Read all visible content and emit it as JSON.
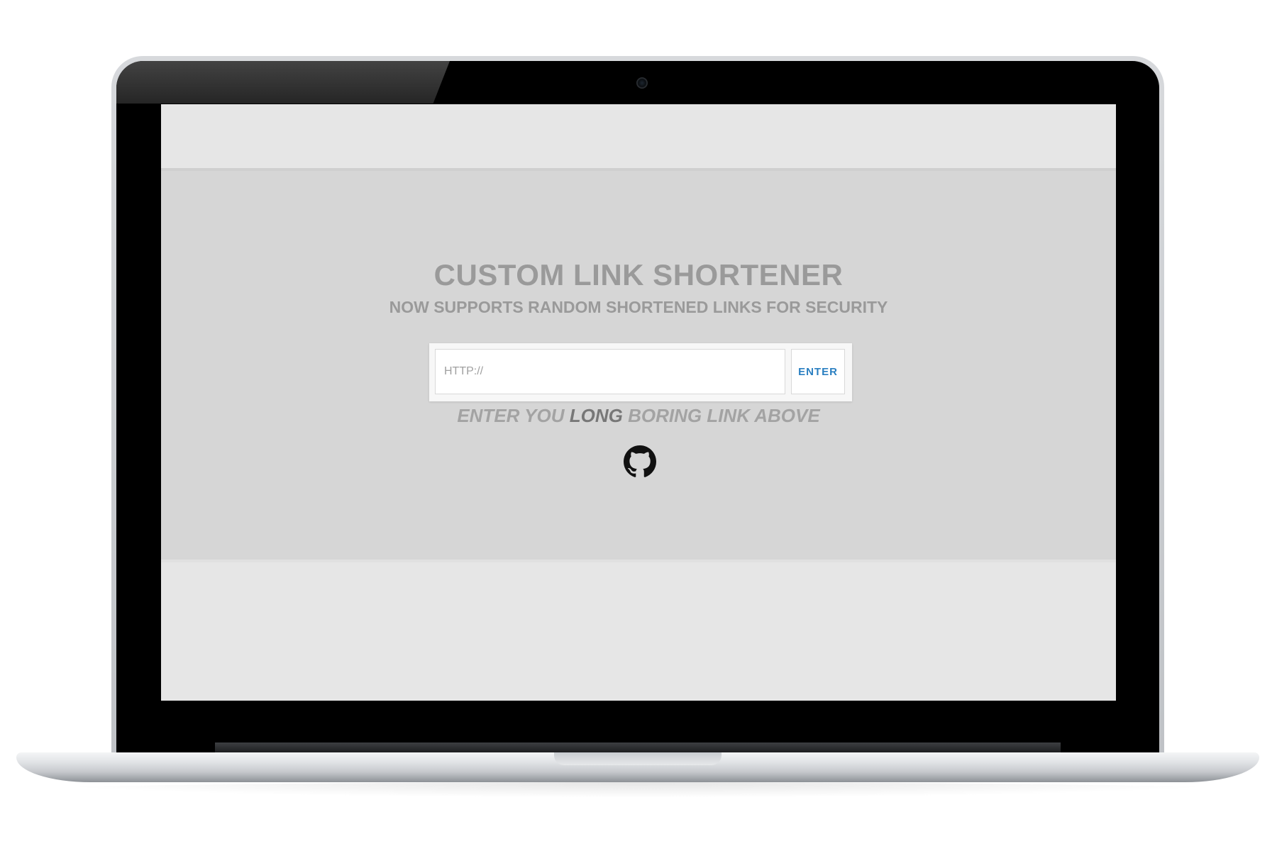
{
  "app": {
    "title": "CUSTOM LINK SHORTENER",
    "subtitle": "NOW SUPPORTS RANDOM SHORTENED LINKS FOR SECURITY"
  },
  "form": {
    "url_input": {
      "placeholder": "HTTP://",
      "value": ""
    },
    "enter_label": "ENTER"
  },
  "hint": {
    "before": "ENTER YOU ",
    "emphasis": "LONG",
    "after": " BORING LINK ABOVE"
  },
  "footer": {
    "github_icon": "github-icon"
  },
  "colors": {
    "accent": "#2a7fc1",
    "heading": "#9a9a9a",
    "main_band": "#d6d6d6",
    "outer_band": "#e6e6e6"
  }
}
